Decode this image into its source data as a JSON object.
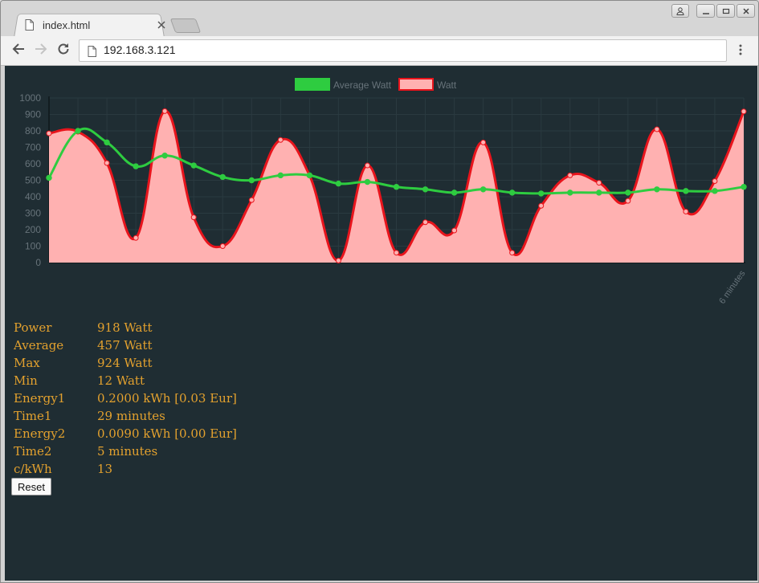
{
  "browser": {
    "tab_title": "index.html",
    "url": "192.168.3.121"
  },
  "chart_data": {
    "type": "line",
    "x_label_last": "6 minutes",
    "ylim": [
      0,
      1000
    ],
    "y_ticks": [
      "0",
      "100",
      "200",
      "300",
      "400",
      "500",
      "600",
      "700",
      "800",
      "900",
      "1000"
    ],
    "legend_position": "top-center",
    "grid": true,
    "series": [
      {
        "name": "Average Watt",
        "color": "#2ecc40",
        "fill": false,
        "values": [
          515,
          800,
          730,
          585,
          650,
          590,
          520,
          500,
          530,
          530,
          480,
          490,
          460,
          445,
          425,
          445,
          425,
          420,
          425,
          425,
          425,
          445,
          435,
          435,
          460
        ]
      },
      {
        "name": "Watt",
        "color": "#e8141c",
        "fill": true,
        "fill_color": "#ffb1b1",
        "values": [
          785,
          795,
          605,
          150,
          920,
          275,
          100,
          380,
          745,
          530,
          12,
          590,
          60,
          245,
          195,
          730,
          60,
          345,
          530,
          485,
          375,
          810,
          310,
          495,
          918
        ]
      }
    ]
  },
  "stats": [
    {
      "label": "Power",
      "value": "918 Watt"
    },
    {
      "label": "Average",
      "value": "457 Watt"
    },
    {
      "label": "Max",
      "value": "924 Watt"
    },
    {
      "label": "Min",
      "value": "12 Watt"
    },
    {
      "label": "Energy1",
      "value": "0.2000 kWh [0.03 Eur]"
    },
    {
      "label": "Time1",
      "value": "29 minutes"
    },
    {
      "label": "Energy2",
      "value": "0.0090 kWh [0.00 Eur]"
    },
    {
      "label": "Time2",
      "value": "5 minutes"
    },
    {
      "label": "c/kWh",
      "value": "13"
    }
  ],
  "reset_label": "Reset",
  "icons": {
    "tab": "page-icon",
    "close": "close-icon",
    "back": "back-arrow-icon",
    "forward": "forward-arrow-icon",
    "reload": "reload-icon",
    "url": "page-icon",
    "menu": "kebab-menu-icon",
    "user": "user-icon"
  }
}
